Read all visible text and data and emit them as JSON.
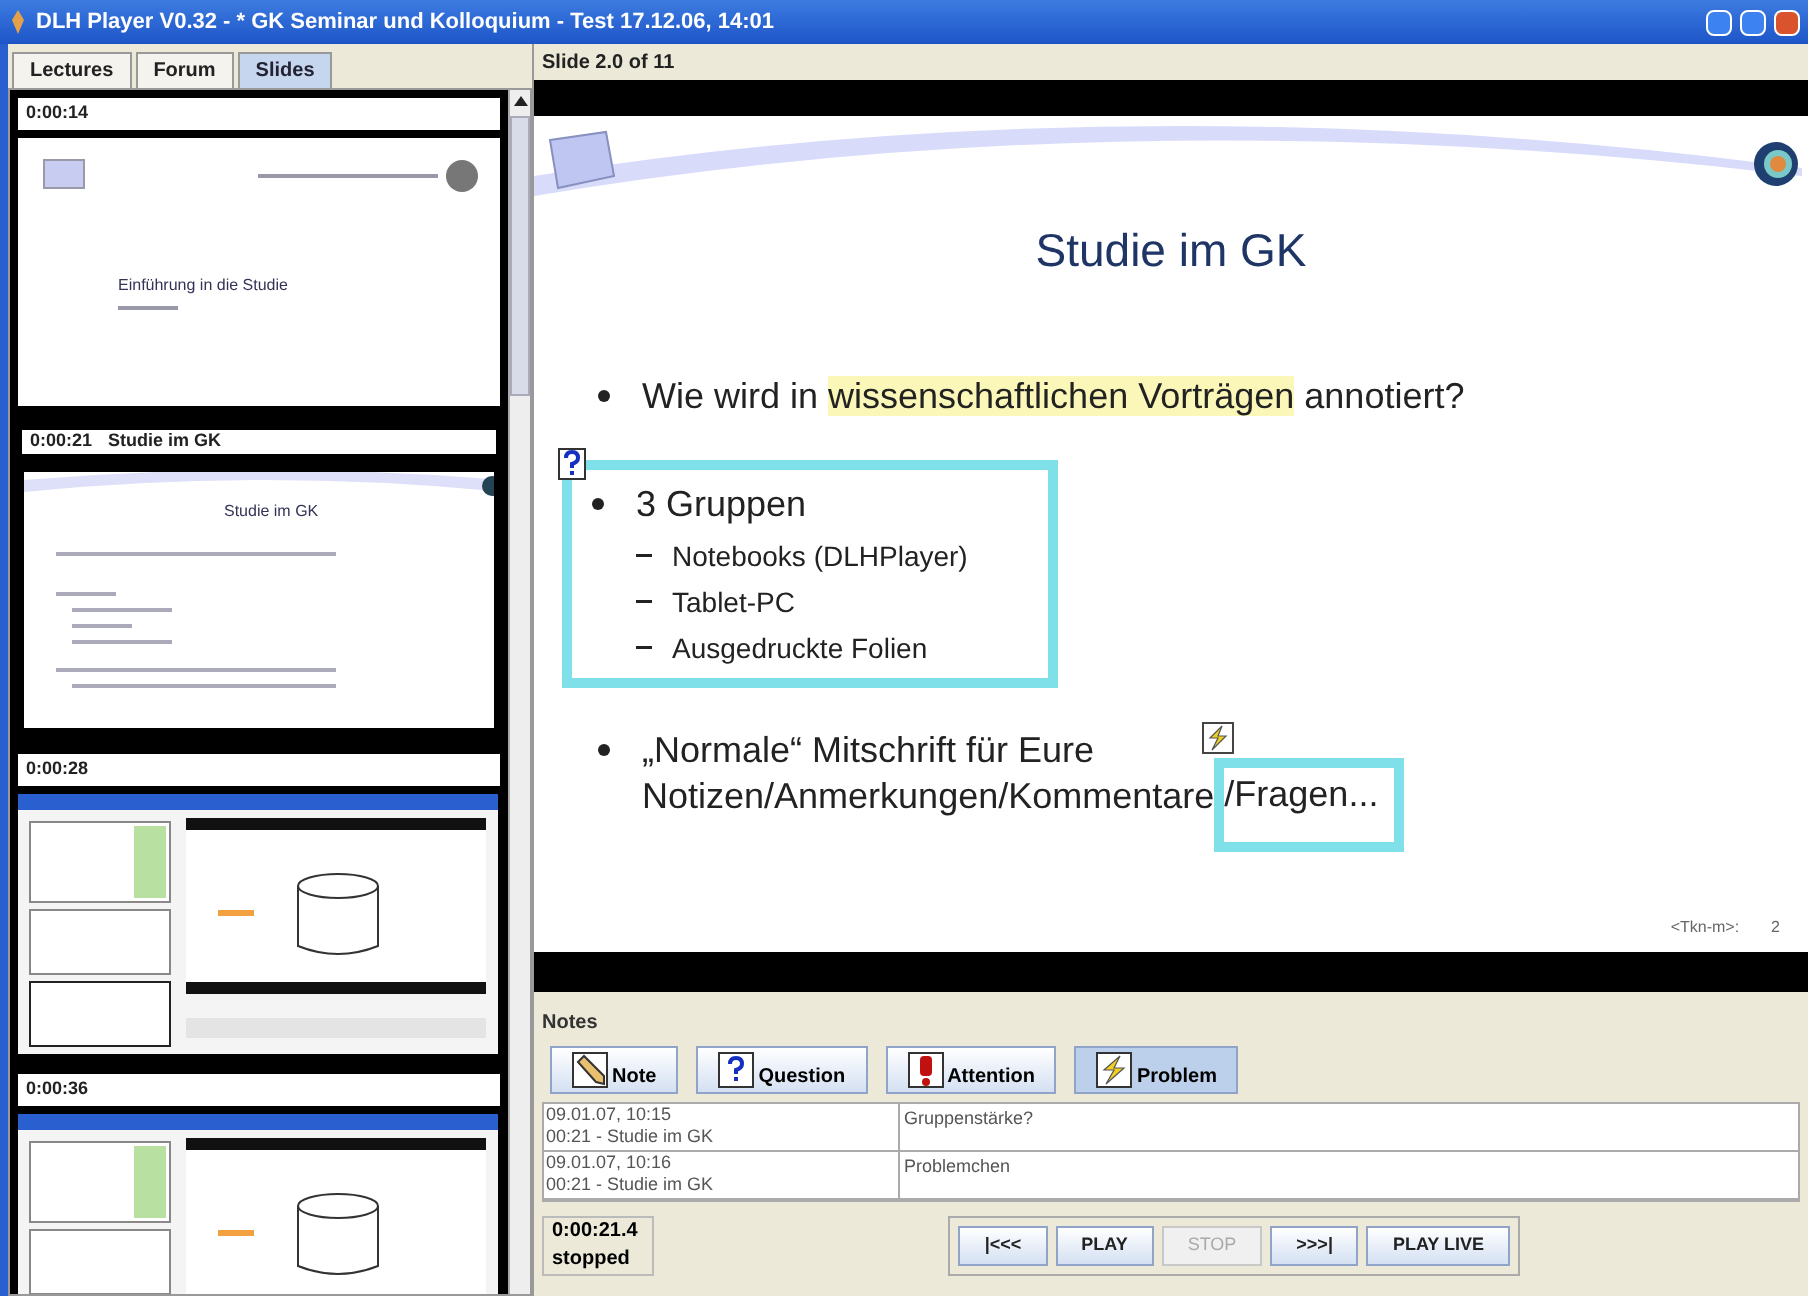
{
  "window": {
    "title": "DLH Player V0.32 - * GK Seminar und Kolloquium - Test 17.12.06, 14:01"
  },
  "tabs": [
    {
      "label": "Lectures",
      "selected": false
    },
    {
      "label": "Forum",
      "selected": false
    },
    {
      "label": "Slides",
      "selected": true
    }
  ],
  "thumbnails": [
    {
      "time": "0:00:14",
      "kind": "title_slide",
      "slide_title": "Einführung in die Studie",
      "selected": false
    },
    {
      "time": "0:00:21",
      "title": "Studie im GK",
      "kind": "content_slide",
      "slide_title": "Studie im GK",
      "selected": true
    },
    {
      "time": "0:00:28",
      "kind": "picture",
      "selected": false
    },
    {
      "time": "0:00:36",
      "kind": "picture",
      "selected": false
    }
  ],
  "slide": {
    "label": "Slide 2.0 of 11",
    "title": "Studie im GK",
    "bullets": [
      {
        "parts": [
          {
            "text": "Wie wird in ",
            "highlight": false
          },
          {
            "text": "wissenschaftlichen Vorträgen",
            "highlight": true
          },
          {
            "text": " annotiert?",
            "highlight": false
          }
        ],
        "kind": "plain"
      },
      {
        "parts": [
          {
            "text": "3 Gruppen",
            "highlight": false
          }
        ],
        "kind": "question",
        "sub": [
          "Notebooks (DLHPlayer)",
          "Tablet-PC",
          "Ausgedruckte Folien"
        ]
      },
      {
        "parts": [
          {
            "text": "„Normale“ Mitschrift für Eure",
            "highlight": false
          }
        ],
        "kind": "plain"
      }
    ],
    "last_line": {
      "before": "Notizen/Anmerkungen/Kommentare",
      "marked": "/Fragen...",
      "kind": "problem"
    },
    "footer": "<Tkn-m>:",
    "page": "2"
  },
  "notes": {
    "title": "Notes",
    "buttons": [
      {
        "label": "Note",
        "kind": "note",
        "selected": false
      },
      {
        "label": "Question",
        "kind": "question",
        "selected": false
      },
      {
        "label": "Attention",
        "kind": "attention",
        "selected": false
      },
      {
        "label": "Problem",
        "kind": "problem",
        "selected": true
      }
    ],
    "rows": [
      {
        "date": "09.01.07, 10:15",
        "slide": "00:21 - Studie im GK",
        "text": "Gruppenstärke?"
      },
      {
        "date": "09.01.07, 10:16",
        "slide": "00:21 - Studie im GK",
        "text": "Problemchen"
      }
    ]
  },
  "status": {
    "time": "0:00:21.4",
    "state": "stopped"
  },
  "controls": [
    {
      "label": "|<<<",
      "disabled": false
    },
    {
      "label": "PLAY",
      "disabled": false
    },
    {
      "label": "STOP",
      "disabled": true
    },
    {
      "label": ">>>|",
      "disabled": false
    },
    {
      "label": "PLAY LIVE",
      "disabled": false
    }
  ]
}
